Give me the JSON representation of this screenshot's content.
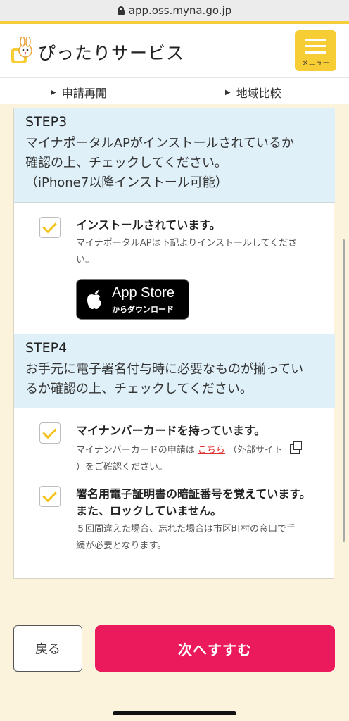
{
  "browser": {
    "url": "app.oss.myna.go.jp"
  },
  "header": {
    "title": "ぴったりサービス",
    "menu_label": "メニュー"
  },
  "subnav": {
    "item1": "申請再開",
    "item2": "地域比較"
  },
  "step3": {
    "title": "STEP3",
    "desc_line1": "マイナポータルAPがインストールされているか",
    "desc_line2": "確認の上、チェックしてください。",
    "desc_line3": "（iPhone7以降インストール可能）",
    "check_title": "インストールされています。",
    "note_line1": "マイナポータルAPは下記よりインストールしてくださ",
    "note_line2": "い。",
    "appstore_line1": "App Store",
    "appstore_line2": "からダウンロード"
  },
  "step4": {
    "title": "STEP4",
    "desc_line1": "お手元に電子署名付与時に必要なものが揃ってい",
    "desc_line2": "るか確認の上、チェックしてください。",
    "check1_title": "マイナンバーカードを持っています。",
    "check1_note_pre": "マイナンバーカードの申請は",
    "check1_note_link": "こちら",
    "check1_note_post": "（外部サイト",
    "check1_note_line2": "）をご確認ください。",
    "check2_title_line1": "署名用電子証明書の暗証番号を覚えています。",
    "check2_title_line2": "また、ロックしていません。",
    "check2_note_line1": "５回間違えた場合、忘れた場合は市区町村の窓口で手",
    "check2_note_line2": "続が必要となります。"
  },
  "footer": {
    "back_label": "戻る",
    "next_label": "次へすすむ"
  },
  "colors": {
    "accent_yellow": "#f6cd35",
    "primary_pink": "#ea1a5d",
    "step_bg": "#dff0f9",
    "page_bg": "#fbf3dc",
    "link_red": "#e0312e"
  }
}
